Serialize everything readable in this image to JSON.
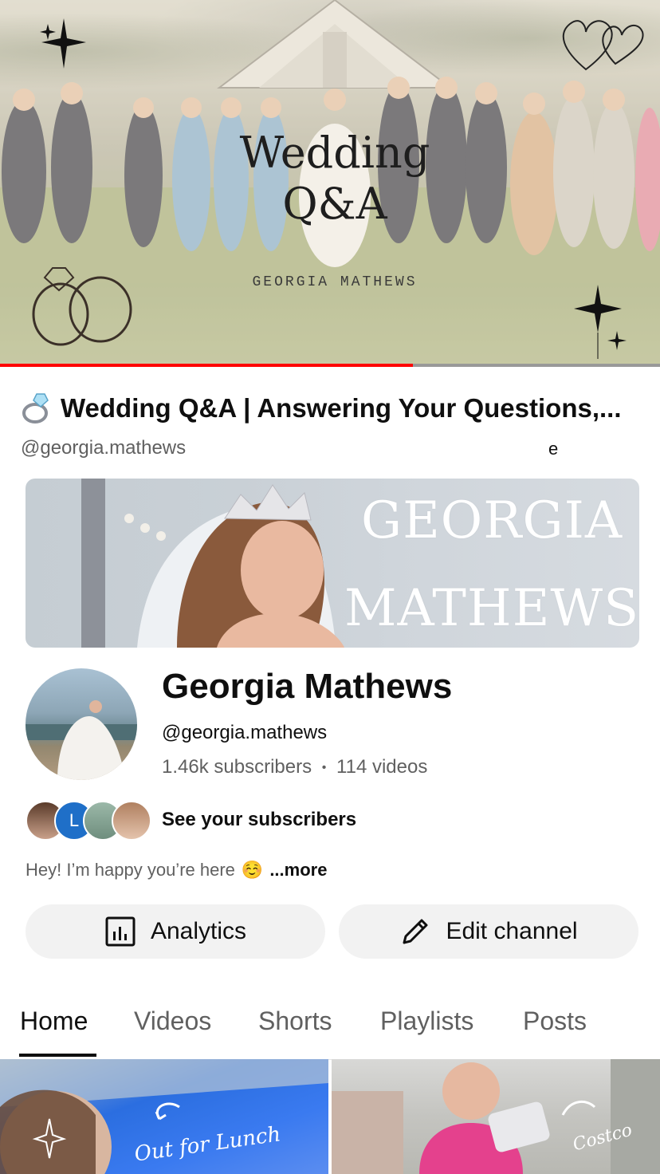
{
  "video": {
    "hero_title_line1": "Wedding",
    "hero_title_line2": "Q&A",
    "hero_subtitle": "GEORGIA MATHEWS",
    "progress": 0.626,
    "title": "Wedding Q&A | Answering Your Questions,...",
    "handle": "@georgia.mathews",
    "stray_char": "e"
  },
  "banner": {
    "line1": "GEORGIA",
    "line2": "MATHEWS"
  },
  "channel": {
    "name": "Georgia Mathews",
    "handle": "@georgia.mathews",
    "subscribers": "1.46k subscribers",
    "separator": "•",
    "videos": "114 videos",
    "see_subscribers": "See your subscribers",
    "subscriber_letter": "L",
    "description": "Hey! I’m happy you’re here",
    "description_emoji": "☺️",
    "more": "...more"
  },
  "buttons": {
    "analytics": "Analytics",
    "edit_channel": "Edit channel"
  },
  "tabs": [
    "Home",
    "Videos",
    "Shorts",
    "Playlists",
    "Posts"
  ],
  "active_tab": "Home",
  "thumbnails": [
    {
      "label": "Out for Lunch"
    },
    {
      "label": "Costco"
    }
  ],
  "colors": {
    "progress": "#ff0000",
    "text_primary": "#0f0f0f",
    "text_secondary": "#606060",
    "button_bg": "#f2f2f2"
  },
  "icons": {
    "ring": "ring-icon",
    "analytics": "analytics-icon",
    "edit": "pencil-icon"
  }
}
